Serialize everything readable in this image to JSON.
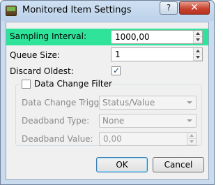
{
  "window": {
    "title": "Monitored Item Settings",
    "help_label": "?",
    "close_label": "✕"
  },
  "form": {
    "sampling_interval": {
      "label": "Sampling Interval:",
      "value": "1000,00",
      "highlight_color": "#2fe39a"
    },
    "queue_size": {
      "label": "Queue Size:",
      "value": "1"
    },
    "discard_oldest": {
      "label": "Discard Oldest:",
      "checked": true,
      "check_glyph": "✓"
    },
    "data_change_filter": {
      "label": "Data Change Filter",
      "checked": false,
      "trigger": {
        "label": "Data Change Trigger:",
        "value": "Status/Value"
      },
      "deadband_type": {
        "label": "Deadband Type:",
        "value": "None"
      },
      "deadband_value": {
        "label": "Deadband Value:",
        "value": "0,00"
      }
    }
  },
  "buttons": {
    "ok": "OK",
    "cancel": "Cancel"
  }
}
